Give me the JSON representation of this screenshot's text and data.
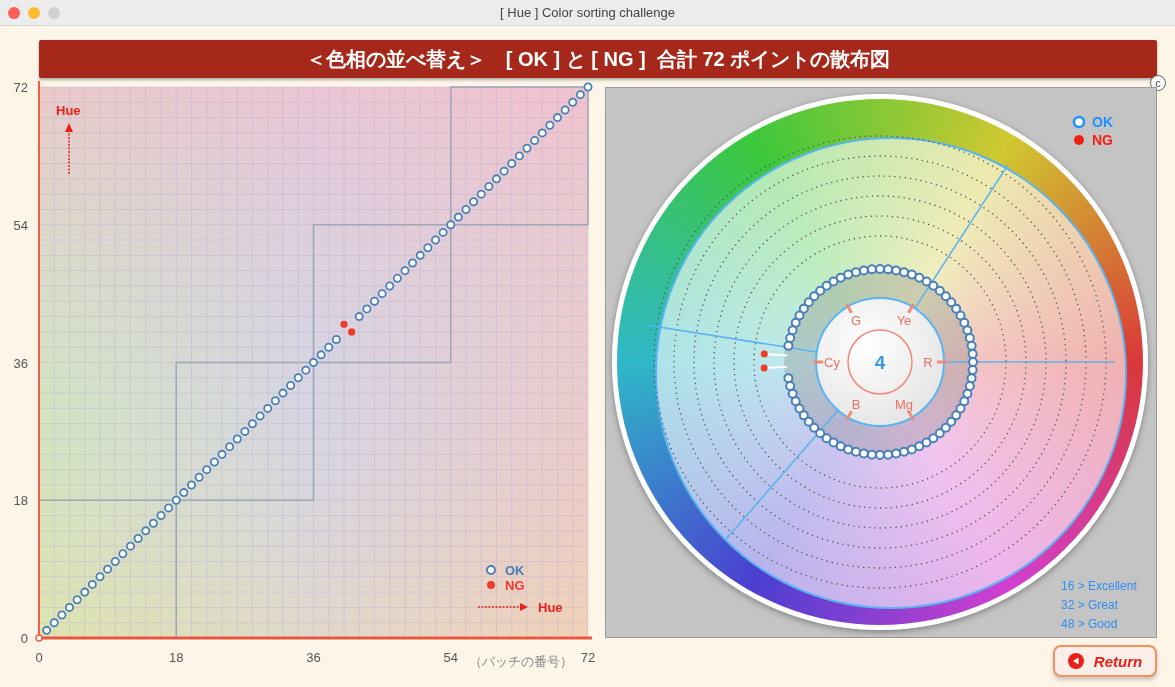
{
  "window": {
    "title": "[ Hue ] Color sorting challenge"
  },
  "banner": {
    "title": "＜色相の並べ替え＞　[ OK ] と [ NG ]  合計 72 ポイントの散布図",
    "badge": "c"
  },
  "left_chart": {
    "y_hint": "Hue",
    "x_hint": "Hue",
    "chart_data": {
      "type": "scatter",
      "xlabel": "（パッチの番号）",
      "x": [
        1,
        2,
        3,
        4,
        5,
        6,
        7,
        8,
        9,
        10,
        11,
        12,
        13,
        14,
        15,
        16,
        17,
        18,
        19,
        20,
        21,
        22,
        23,
        24,
        25,
        26,
        27,
        28,
        29,
        30,
        31,
        32,
        33,
        34,
        35,
        36,
        37,
        38,
        39,
        40,
        41,
        42,
        43,
        44,
        45,
        46,
        47,
        48,
        49,
        50,
        51,
        52,
        53,
        54,
        55,
        56,
        57,
        58,
        59,
        60,
        61,
        62,
        63,
        64,
        65,
        66,
        67,
        68,
        69,
        70,
        71,
        72
      ],
      "series": [
        {
          "name": "OK",
          "color": "#4a80b8",
          "values": [
            1,
            2,
            3,
            4,
            5,
            6,
            7,
            8,
            9,
            10,
            11,
            12,
            13,
            14,
            15,
            16,
            17,
            18,
            19,
            20,
            21,
            22,
            23,
            24,
            25,
            26,
            27,
            28,
            29,
            30,
            31,
            32,
            33,
            34,
            35,
            36,
            37,
            38,
            39,
            null,
            null,
            42,
            43,
            44,
            45,
            46,
            47,
            48,
            49,
            50,
            51,
            52,
            53,
            54,
            55,
            56,
            57,
            58,
            59,
            60,
            61,
            62,
            63,
            64,
            65,
            66,
            67,
            68,
            69,
            70,
            71,
            72
          ]
        },
        {
          "name": "NG",
          "color": "#f03a2a",
          "values": [
            null,
            null,
            null,
            null,
            null,
            null,
            null,
            null,
            null,
            null,
            null,
            null,
            null,
            null,
            null,
            null,
            null,
            null,
            null,
            null,
            null,
            null,
            null,
            null,
            null,
            null,
            null,
            null,
            null,
            null,
            null,
            null,
            null,
            null,
            null,
            null,
            null,
            null,
            null,
            41,
            40,
            null,
            null,
            null,
            null,
            null,
            null,
            null,
            null,
            null,
            null,
            null,
            null,
            null,
            null,
            null,
            null,
            null,
            null,
            null,
            null,
            null,
            null,
            null,
            null,
            null,
            null,
            null,
            null,
            null,
            null,
            null
          ]
        }
      ],
      "grid": true,
      "legend": true,
      "xlim": [
        0,
        72
      ],
      "ylim": [
        0,
        72
      ],
      "xticks": [
        0,
        18,
        36,
        54,
        72
      ],
      "yticks": [
        0,
        18,
        36,
        54,
        72
      ]
    }
  },
  "wheel": {
    "center_value": "4",
    "hue_labels": [
      "R",
      "Ye",
      "G",
      "Cy",
      "B",
      "Mg"
    ],
    "legend": [
      {
        "label": "OK",
        "kind": "ok"
      },
      {
        "label": "NG",
        "kind": "ng"
      }
    ],
    "scores": [
      "16 > Excellent",
      "32 > Great",
      "48 > Good"
    ]
  },
  "return_button": {
    "label": "Return"
  }
}
